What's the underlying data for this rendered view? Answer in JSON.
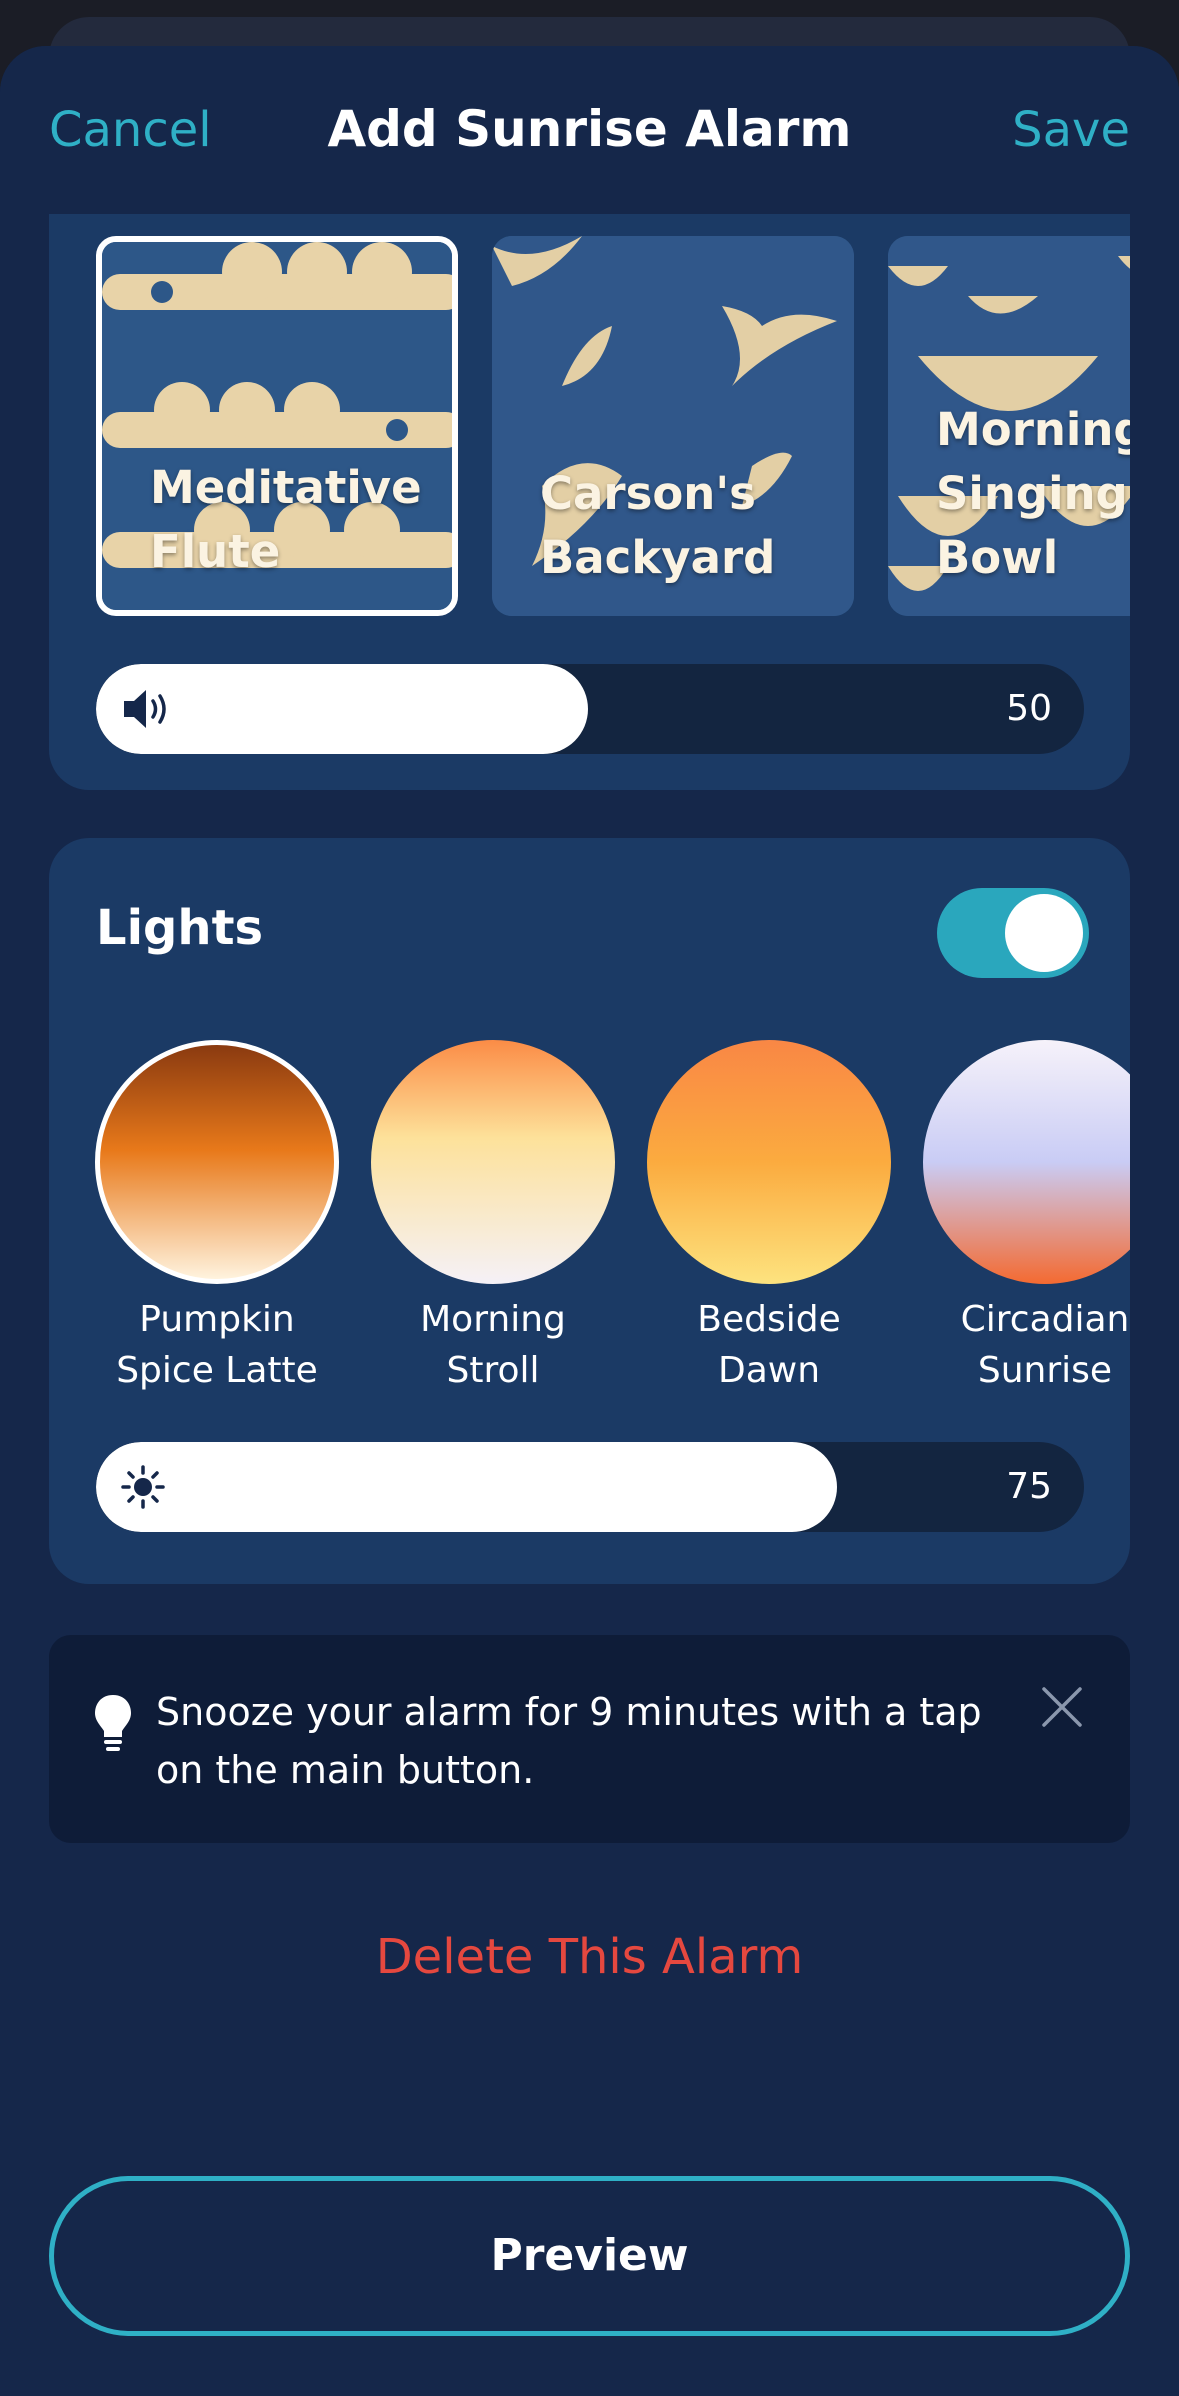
{
  "header": {
    "cancel_label": "Cancel",
    "title": "Add Sunrise Alarm",
    "save_label": "Save"
  },
  "sounds": {
    "tiles": [
      {
        "label": "Meditative Flute",
        "selected": true
      },
      {
        "label": "Carson's Backyard",
        "selected": false
      },
      {
        "label": "Morning Singing Bowl",
        "selected": false
      }
    ],
    "volume": {
      "value": "50",
      "icon": "speaker-icon"
    }
  },
  "lights": {
    "title": "Lights",
    "enabled": true,
    "swatches": [
      {
        "name": "Pumpkin Spice Latte",
        "selected": true,
        "colors": [
          "#8a3a10",
          "#e8791a",
          "#fff3de"
        ]
      },
      {
        "name": "Morning Stroll",
        "selected": false,
        "colors": [
          "#fb8c46",
          "#fde19a",
          "#f5f1f7"
        ]
      },
      {
        "name": "Bedside Dawn",
        "selected": false,
        "colors": [
          "#f98745",
          "#fbab3f",
          "#fde37f"
        ]
      },
      {
        "name": "Circadian Sunrise",
        "selected": false,
        "colors": [
          "#f6f2fa",
          "#c9ccf5",
          "#f46a31"
        ]
      }
    ],
    "brightness": {
      "value": "75",
      "icon": "sun-icon"
    }
  },
  "tip": {
    "text": "Snooze your alarm for 9 minutes with a tap on the main button.",
    "icon": "lightbulb-icon"
  },
  "delete_label": "Delete This Alarm",
  "preview_label": "Preview",
  "colors": {
    "accent": "#2fb0c6",
    "danger": "#e5483f",
    "background": "#15274a",
    "card": "#1b3a65"
  }
}
